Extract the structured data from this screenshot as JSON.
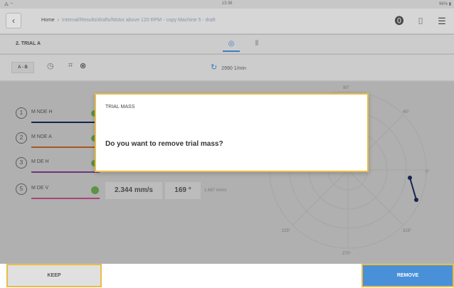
{
  "status_bar": {
    "left": "⁂ ⌔",
    "time": "13:36",
    "battery": "96% ▮"
  },
  "nav": {
    "home": "Home",
    "path": "Internal/Results/drafts/Motor above 120 RPM - copy Machine 5 - draft",
    "help_icon": "help-icon",
    "camera_icon": "camera-icon",
    "menu_icon": "menu-icon"
  },
  "tabs": {
    "trial": "2. TRIAL A"
  },
  "toolbar": {
    "ab": "A - B",
    "rpm": "2990 1/min"
  },
  "measurements": [
    {
      "num": "1",
      "label": "M NDE H",
      "color": "#1c2a5a"
    },
    {
      "num": "2",
      "label": "M NDE A",
      "color": "#c0632b"
    },
    {
      "num": "3",
      "label": "M DE H",
      "color": "#7a3d8e"
    },
    {
      "num": "5",
      "label": "M DE V",
      "color": "#c04d8c"
    }
  ],
  "reading": {
    "amplitude": "2.344 mm/s",
    "phase": "169 °",
    "small": "1.687 mm/s"
  },
  "polar": {
    "labels": {
      "a90": "90°",
      "a45": "45°",
      "a0": "0°",
      "a315": "315°",
      "a270": "270°",
      "a225": "225°"
    }
  },
  "dialog": {
    "title": "TRIAL MASS",
    "message": "Do you want to remove trial mass?"
  },
  "buttons": {
    "keep": "KEEP",
    "remove": "REMOVE"
  }
}
